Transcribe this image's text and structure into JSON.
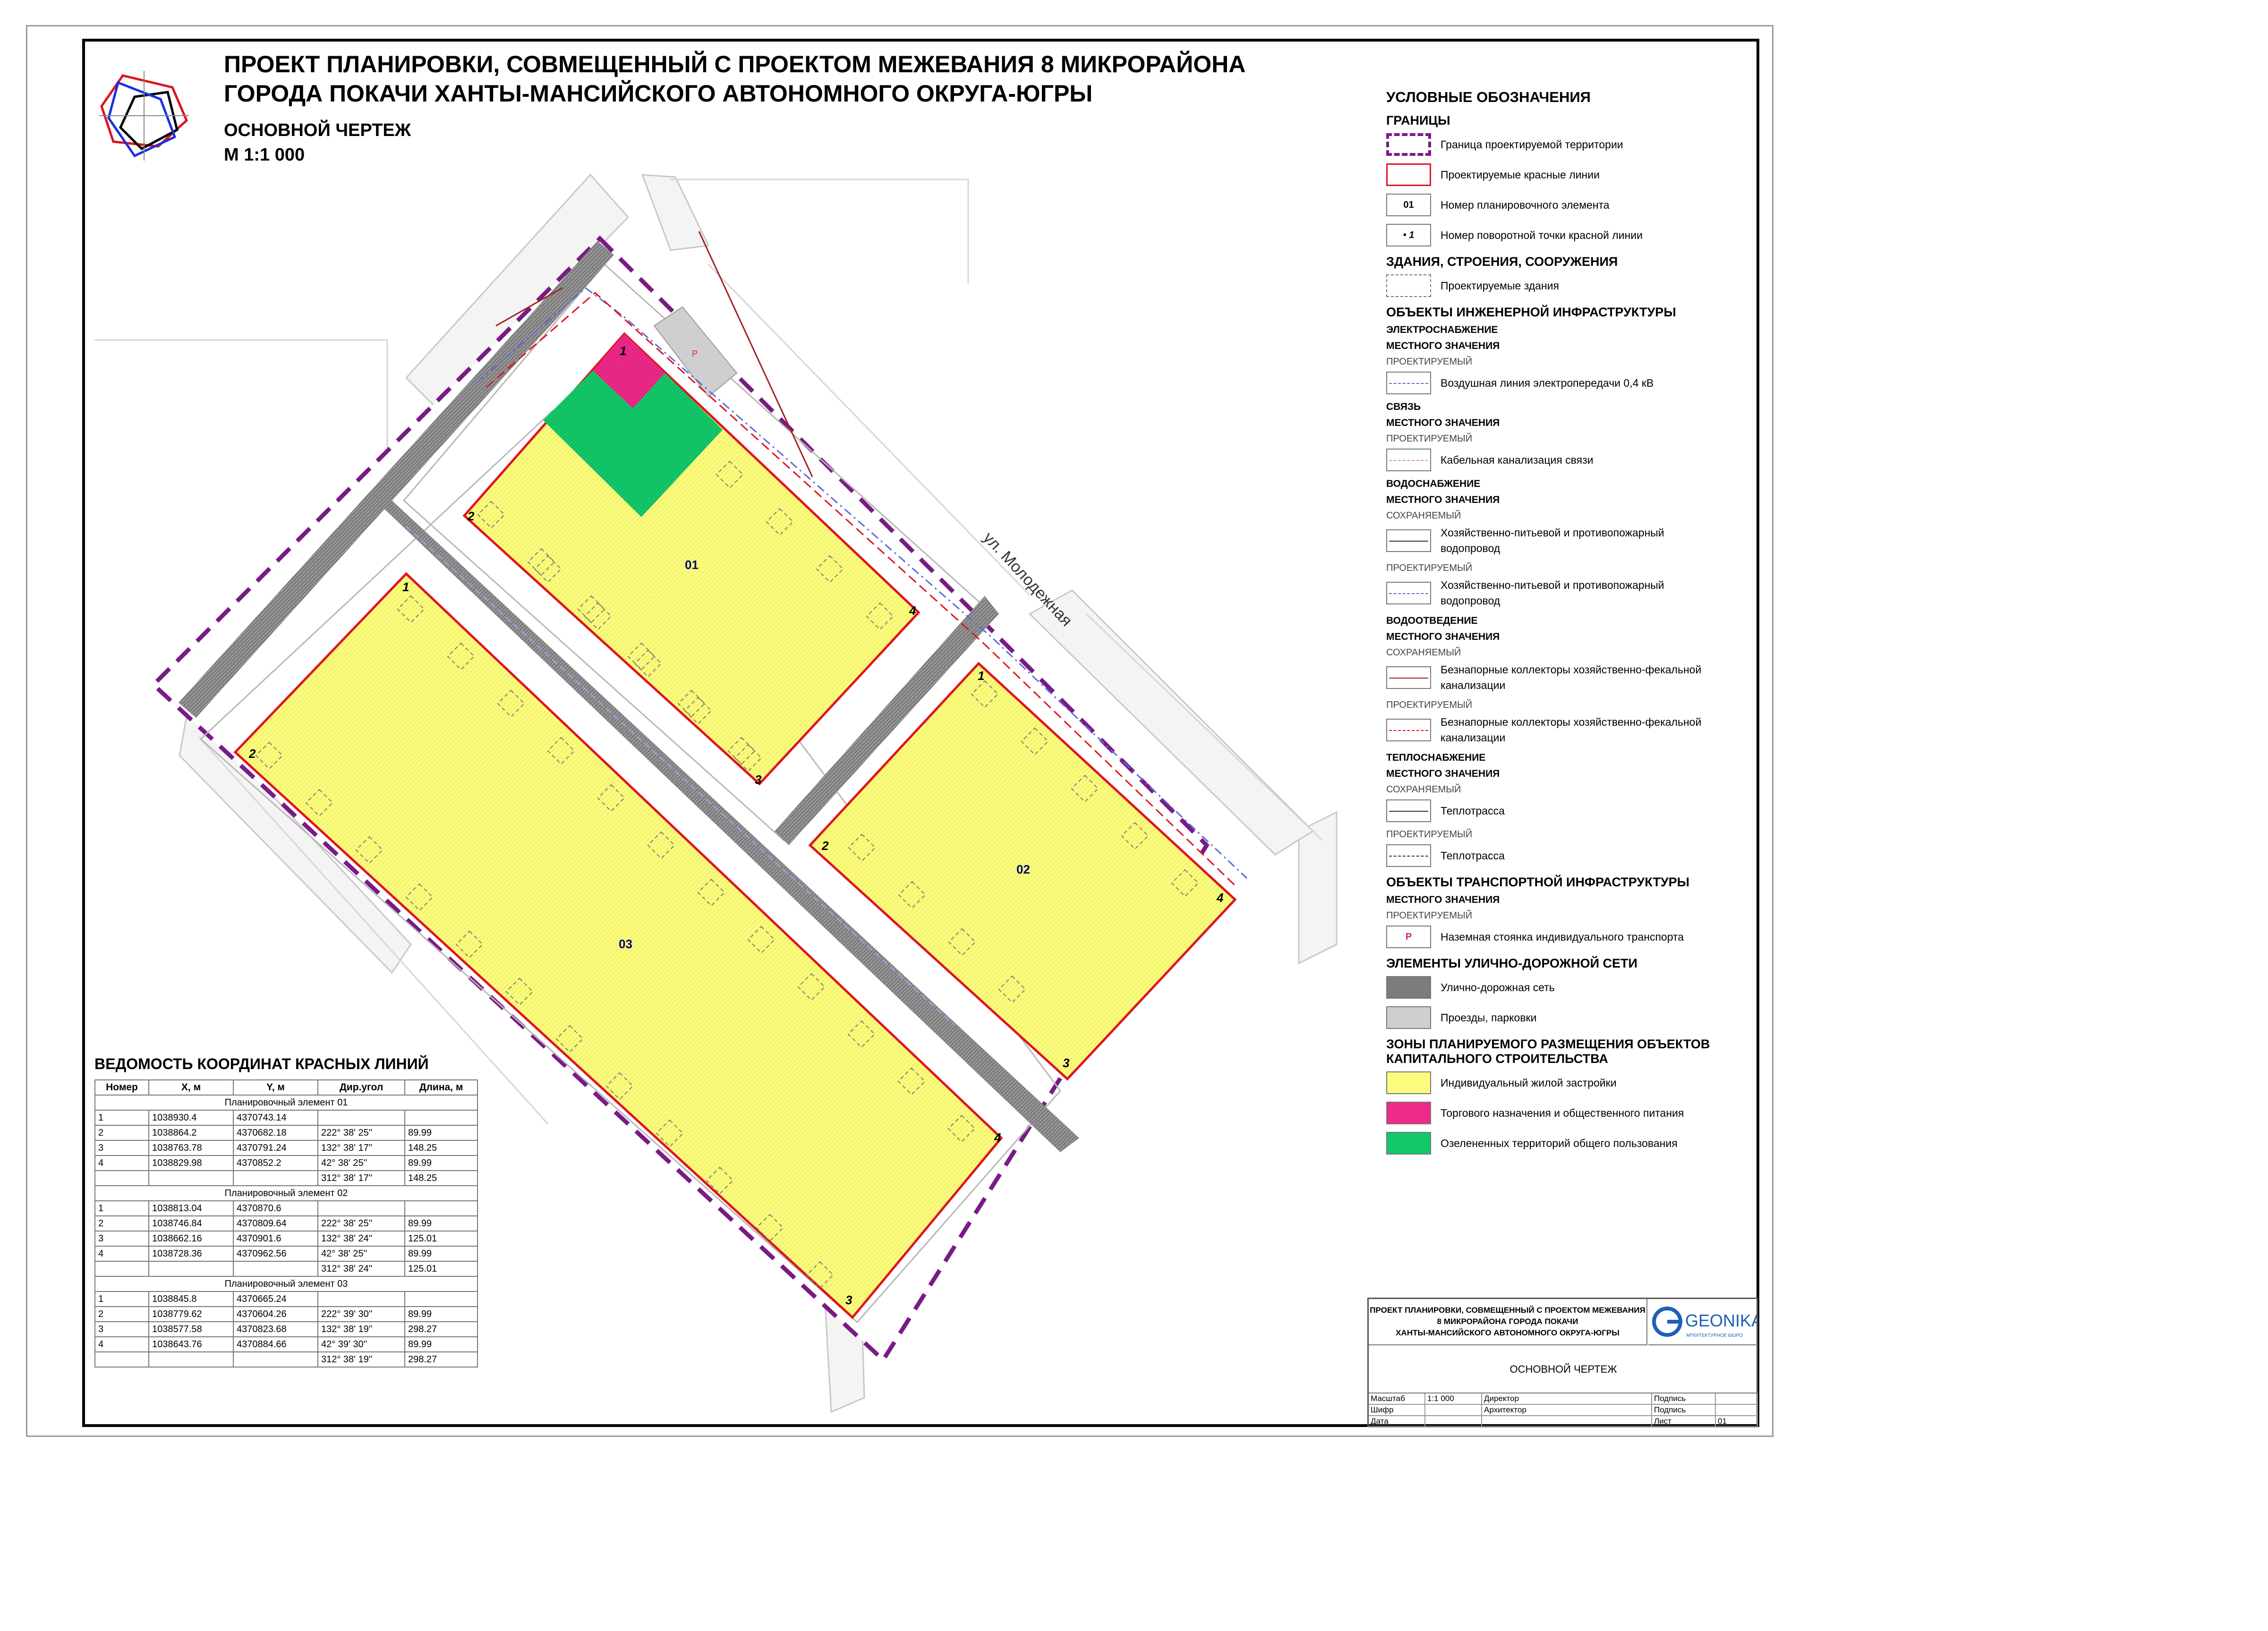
{
  "title": {
    "line1": "ПРОЕКТ ПЛАНИРОВКИ, СОВМЕЩЕННЫЙ С ПРОЕКТОМ МЕЖЕВАНИЯ 8 МИКРОРАЙОНА",
    "line2": "ГОРОДА ПОКАЧИ ХАНТЫ-МАНСИЙСКОГО АВТОНОМНОГО ОКРУГА-ЮГРЫ",
    "drawing": "ОСНОВНОЙ ЧЕРТЕЖ",
    "scale": "М 1:1 000"
  },
  "map": {
    "street_label": "ул. Молодежная",
    "elements": [
      {
        "id": "01",
        "zone": "Индивидуальный жилой застройки"
      },
      {
        "id": "02",
        "zone": "Индивидуальный жилой застройки"
      },
      {
        "id": "03",
        "zone": "Индивидуальный жилой застройки"
      }
    ],
    "turn_points": [
      "1",
      "2",
      "3",
      "4"
    ],
    "parking_symbol": "P",
    "colors": {
      "residential": "#fbfb7d",
      "commercial": "#ee2a8a",
      "green": "#12c96a",
      "road": "#8a8a8a",
      "boundary": "#7a1a86",
      "red_line": "#e0141e"
    }
  },
  "legend": {
    "title": "УСЛОВНЫЕ ОБОЗНАЧЕНИЯ",
    "sections": [
      {
        "head": "ГРАНИЦЫ",
        "items": [
          {
            "sym": "boundary",
            "text": "Граница проектируемой территории"
          },
          {
            "sym": "redline",
            "text": "Проектируемые красные линии"
          },
          {
            "sym": "elemnum",
            "symtext": "01",
            "text": "Номер планировочного элемента"
          },
          {
            "sym": "pointnum",
            "symtext": "1",
            "text": "Номер поворотной точки красной линии"
          }
        ]
      },
      {
        "head": "ЗДАНИЯ, СТРОЕНИЯ, СООРУЖЕНИЯ",
        "items": [
          {
            "sym": "building",
            "text": "Проектируемые здания"
          }
        ]
      },
      {
        "head": "ОБЪЕКТЫ ИНЖЕНЕРНОЙ ИНФРАСТРУКТУРЫ",
        "subs": [
          {
            "sub": "ЭЛЕКТРОСНАБЖЕНИЕ",
            "level": "МЕСТНОГО ЗНАЧЕНИЯ",
            "groups": [
              {
                "status": "ПРОЕКТИРУЕМЫЙ",
                "items": [
                  {
                    "sym": "power",
                    "text": "Воздушная линия электропередачи 0,4 кВ"
                  }
                ]
              }
            ]
          },
          {
            "sub": "СВЯЗЬ",
            "level": "МЕСТНОГО ЗНАЧЕНИЯ",
            "groups": [
              {
                "status": "ПРОЕКТИРУЕМЫЙ",
                "items": [
                  {
                    "sym": "comm",
                    "text": "Кабельная канализация связи"
                  }
                ]
              }
            ]
          },
          {
            "sub": "ВОДОСНАБЖЕНИЕ",
            "level": "МЕСТНОГО ЗНАЧЕНИЯ",
            "groups": [
              {
                "status": "СОХРАНЯЕМЫЙ",
                "items": [
                  {
                    "sym": "water-keep",
                    "text": "Хозяйственно-питьевой и противопожарный водопровод"
                  }
                ]
              },
              {
                "status": "ПРОЕКТИРУЕМЫЙ",
                "items": [
                  {
                    "sym": "water-new",
                    "text": "Хозяйственно-питьевой и противопожарный водопровод"
                  }
                ]
              }
            ]
          },
          {
            "sub": "ВОДООТВЕДЕНИЕ",
            "level": "МЕСТНОГО ЗНАЧЕНИЯ",
            "groups": [
              {
                "status": "СОХРАНЯЕМЫЙ",
                "items": [
                  {
                    "sym": "sewer-keep",
                    "text": "Безнапорные коллекторы хозяйственно-фекальной канализации"
                  }
                ]
              },
              {
                "status": "ПРОЕКТИРУЕМЫЙ",
                "items": [
                  {
                    "sym": "sewer-new",
                    "text": "Безнапорные коллекторы хозяйственно-фекальной канализации"
                  }
                ]
              }
            ]
          },
          {
            "sub": "ТЕПЛОСНАБЖЕНИЕ",
            "level": "МЕСТНОГО ЗНАЧЕНИЯ",
            "groups": [
              {
                "status": "СОХРАНЯЕМЫЙ",
                "items": [
                  {
                    "sym": "heat-keep",
                    "text": "Теплотрасса"
                  }
                ]
              },
              {
                "status": "ПРОЕКТИРУЕМЫЙ",
                "items": [
                  {
                    "sym": "heat-new",
                    "text": "Теплотрасса"
                  }
                ]
              }
            ]
          }
        ]
      },
      {
        "head": "ОБЪЕКТЫ ТРАНСПОРТНОЙ ИНФРАСТРУКТУРЫ",
        "subs": [
          {
            "sub": "",
            "level": "МЕСТНОГО ЗНАЧЕНИЯ",
            "groups": [
              {
                "status": "ПРОЕКТИРУЕМЫЙ",
                "items": [
                  {
                    "sym": "parking",
                    "symtext": "P",
                    "text": "Наземная стоянка индивидуального транспорта"
                  }
                ]
              }
            ]
          }
        ]
      },
      {
        "head": "ЭЛЕМЕНТЫ УЛИЧНО-ДОРОЖНОЙ СЕТИ",
        "items": [
          {
            "sym": "road",
            "text": "Улично-дорожная сеть"
          },
          {
            "sym": "drive",
            "text": "Проезды, парковки"
          }
        ]
      },
      {
        "head": "ЗОНЫ ПЛАНИРУЕМОГО РАЗМЕЩЕНИЯ ОБЪЕКТОВ КАПИТАЛЬНОГО СТРОИТЕЛЬСТВА",
        "items": [
          {
            "sym": "zone-res",
            "text": "Индивидуальный жилой застройки"
          },
          {
            "sym": "zone-com",
            "text": "Торгового назначения и общественного питания"
          },
          {
            "sym": "zone-green",
            "text": "Озелененных территорий общего пользования"
          }
        ]
      }
    ]
  },
  "coords": {
    "title": "ВЕДОМОСТЬ КООРДИНАТ КРАСНЫХ ЛИНИЙ",
    "headers": [
      "Номер",
      "X, м",
      "Y, м",
      "Дир.угол",
      "Длина, м"
    ],
    "sections": [
      {
        "name": "Планировочный элемент 01",
        "points": [
          [
            "1",
            "1038930.4",
            "4370743.14"
          ],
          [
            "2",
            "1038864.2",
            "4370682.18"
          ],
          [
            "3",
            "1038763.78",
            "4370791.24"
          ],
          [
            "4",
            "1038829.98",
            "4370852.2"
          ]
        ],
        "segments": [
          [
            "222° 38' 25''",
            "89.99"
          ],
          [
            "132° 38' 17''",
            "148.25"
          ],
          [
            "42° 38' 25''",
            "89.99"
          ],
          [
            "312° 38' 17''",
            "148.25"
          ]
        ]
      },
      {
        "name": "Планировочный элемент 02",
        "points": [
          [
            "1",
            "1038813.04",
            "4370870.6"
          ],
          [
            "2",
            "1038746.84",
            "4370809.64"
          ],
          [
            "3",
            "1038662.16",
            "4370901.6"
          ],
          [
            "4",
            "1038728.36",
            "4370962.56"
          ]
        ],
        "segments": [
          [
            "222° 38' 25''",
            "89.99"
          ],
          [
            "132° 38' 24''",
            "125.01"
          ],
          [
            "42° 38' 25''",
            "89.99"
          ],
          [
            "312° 38' 24''",
            "125.01"
          ]
        ]
      },
      {
        "name": "Планировочный элемент 03",
        "points": [
          [
            "1",
            "1038845.8",
            "4370665.24"
          ],
          [
            "2",
            "1038779.62",
            "4370604.26"
          ],
          [
            "3",
            "1038577.58",
            "4370823.68"
          ],
          [
            "4",
            "1038643.76",
            "4370884.66"
          ]
        ],
        "segments": [
          [
            "222° 39' 30''",
            "89.99"
          ],
          [
            "132° 38' 19''",
            "298.27"
          ],
          [
            "42° 39' 30''",
            "89.99"
          ],
          [
            "312° 38' 19''",
            "298.27"
          ]
        ]
      }
    ]
  },
  "title_block": {
    "project": [
      "ПРОЕКТ ПЛАНИРОВКИ, СОВМЕЩЕННЫЙ С ПРОЕКТОМ МЕЖЕВАНИЯ",
      "8 МИКРОРАЙОНА ГОРОДА ПОКАЧИ",
      "ХАНТЫ-МАНСИЙСКОГО АВТОНОМНОГО ОКРУГА-ЮГРЫ"
    ],
    "logo": "GEONIKA",
    "logo_sub": "АРХИТЕКТУРНОЕ БЮРО",
    "sheet_name": "ОСНОВНОЙ ЧЕРТЕЖ",
    "rows": [
      [
        "Масштаб",
        "1:1 000",
        "Директор",
        "Подпись"
      ],
      [
        "Шифр",
        "",
        "Архитектор",
        "Подпись"
      ],
      [
        "Дата",
        "",
        "",
        "Лист",
        "01"
      ]
    ]
  }
}
